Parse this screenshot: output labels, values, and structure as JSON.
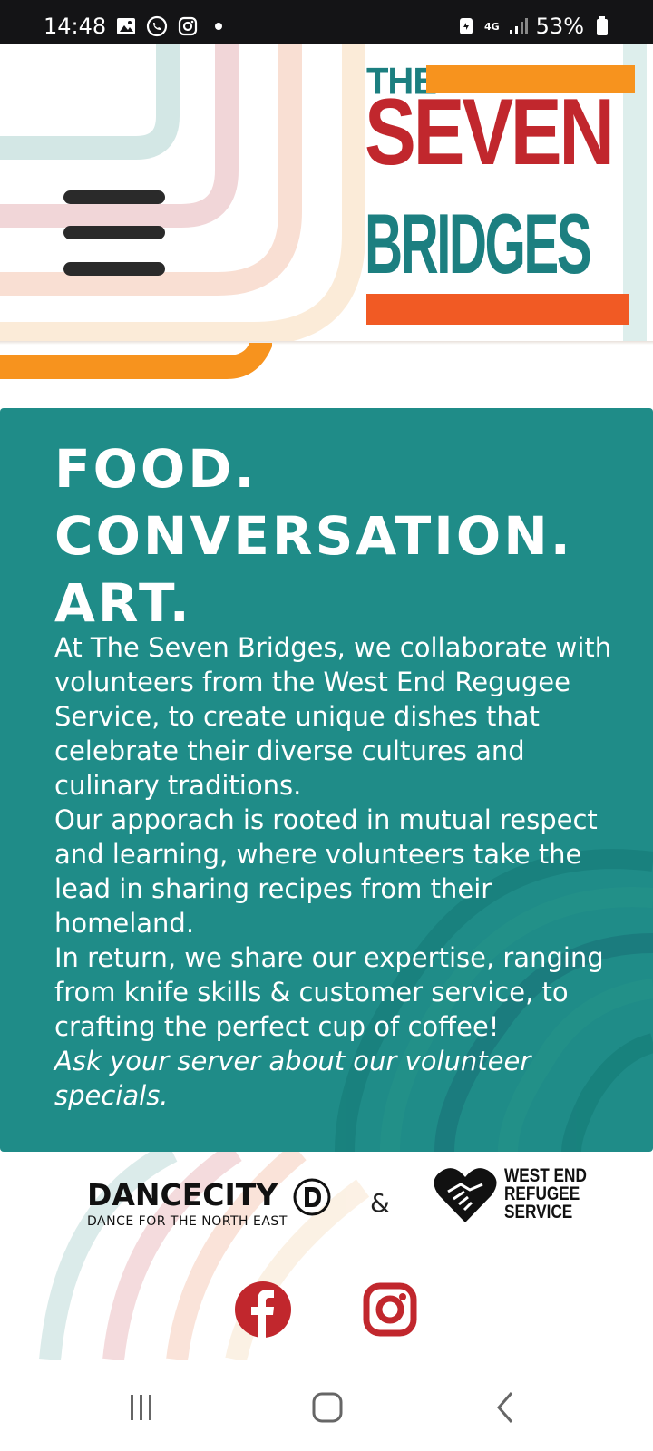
{
  "status_bar": {
    "time": "14:48",
    "network": "4G",
    "battery": "53%"
  },
  "header": {
    "logo": {
      "line1": "THE",
      "line2": "SEVEN",
      "line3": "BRIDGES"
    },
    "menu_icon": "hamburger-menu-icon"
  },
  "main": {
    "headline": [
      "FOOD.",
      "CONVERSATION.",
      "ART."
    ],
    "paragraphs": [
      "At The Seven Bridges, we collaborate with volunteers from the West End Regugee Service, to create unique dishes that celebrate their diverse cultures and culinary traditions.",
      "Our apporach is rooted in mutual respect and learning, where volunteers take the lead in sharing recipes from their homeland.",
      "In return, we share our expertise, ranging from knife skills & customer service, to crafting the perfect cup of coffee!"
    ],
    "italic_note": "Ask your server about our volunteer specials."
  },
  "partners": {
    "dancecity_name": "DANCECITY",
    "dancecity_tagline": "DANCE FOR THE NORTH EAST",
    "ampersand": "&",
    "wers_line1": "WEST END",
    "wers_line2": "REFUGEE",
    "wers_line3": "SERVICE"
  },
  "social": {
    "facebook": "facebook-icon",
    "instagram": "instagram-icon"
  },
  "colors": {
    "teal": "#1f8c88",
    "red": "#c1272d",
    "orange": "#f7931e",
    "logo_teal": "#1c7f80"
  }
}
